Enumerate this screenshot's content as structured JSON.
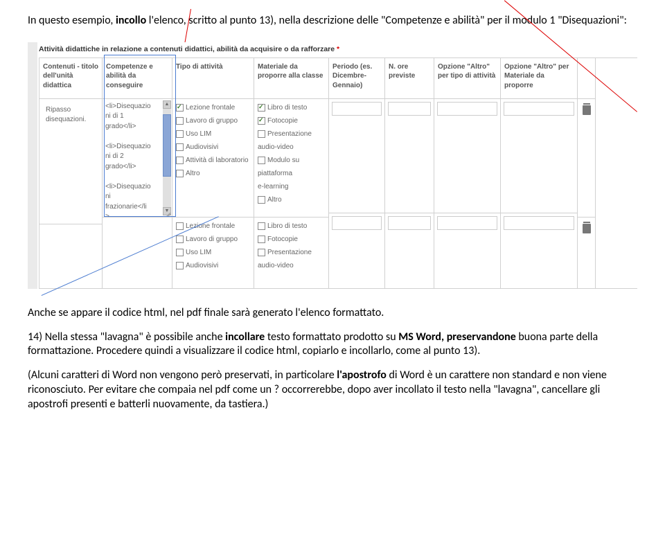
{
  "intro": "In questo esempio, <b>incollo</b> l'elenco, scritto al punto 13), nella descrizione delle \"Competenze e abilità\" per il modulo 1 \"Disequazioni\":",
  "sectionTitle": "Attività didattiche in relazione a contenuti didattici, abilità da acquisire o da rafforzare",
  "headers": {
    "c1": "Contenuti - titolo dell'unità didattica",
    "c2": "Competenze e abilità da conseguire",
    "c3": "Tipo di attività",
    "c4": "Materiale da proporre alla classe",
    "c5": "Periodo (es. Dicembre-Gennaio)",
    "c6": "N. ore previste",
    "c7": "Opzione \"Altro\" per tipo di attività",
    "c8": "Opzione \"Altro\" per Materiale da proporre"
  },
  "row1": {
    "contenuti": "Ripasso disequazioni.",
    "competenze": "<li>Disequazio\nni di 1\ngrado</li>\n\n<li>Disequazio\nni di 2\ngrado</li>\n\n<li>Disequazio\nni\nfrazionarie</li\n>\n</ul>"
  },
  "tipoAttivita": [
    {
      "label": "Lezione frontale",
      "checked": true
    },
    {
      "label": "Lavoro di gruppo",
      "checked": false
    },
    {
      "label": "Uso LIM",
      "checked": false
    },
    {
      "label": "Audiovisivi",
      "checked": false
    },
    {
      "label": "Attività di laboratorio",
      "checked": false
    },
    {
      "label": "Altro",
      "checked": false
    }
  ],
  "materiale": [
    {
      "label": "Libro di testo",
      "checked": true
    },
    {
      "label": "Fotocopie",
      "checked": true
    },
    {
      "label": "Presentazione",
      "checked": false
    },
    {
      "label": "audio-video",
      "plain": true
    },
    {
      "label": "Modulo su",
      "checked": false
    },
    {
      "label": "piattaforma",
      "plain": true
    },
    {
      "label": "e-learning",
      "plain": true
    },
    {
      "label": "Altro",
      "checked": false
    }
  ],
  "tipoAttivita2": [
    {
      "label": "Lezione frontale",
      "checked": false
    },
    {
      "label": "Lavoro di gruppo",
      "checked": false
    },
    {
      "label": "Uso LIM",
      "checked": false
    },
    {
      "label": "Audiovisivi",
      "checked": false
    }
  ],
  "materiale2": [
    {
      "label": "Libro di testo",
      "checked": false
    },
    {
      "label": "Fotocopie",
      "checked": false
    },
    {
      "label": "Presentazione",
      "checked": false
    },
    {
      "label": "audio-video",
      "plain": true
    }
  ],
  "para1": "Anche se appare il codice html, nel pdf finale sarà generato l'elenco formattato.",
  "para2": "14) Nella stessa \"lavagna\" è possibile anche <b>incollare</b> testo formattato prodotto su <b>MS Word, preservandone</b> buona parte della formattazione. Procedere quindi a visualizzare il codice html, copiarlo e incollarlo, come al punto 13).",
  "para3": "(Alcuni caratteri di Word non vengono però preservati, in particolare <b>l'apostrofo</b> di Word è un carattere non standard e non viene riconosciuto. Per evitare che compaia nel pdf come un ? occorrerebbe, dopo aver incollato il testo nella \"lavagna\", cancellare gli apostrofi presenti e batterli nuovamente, da tastiera.)"
}
